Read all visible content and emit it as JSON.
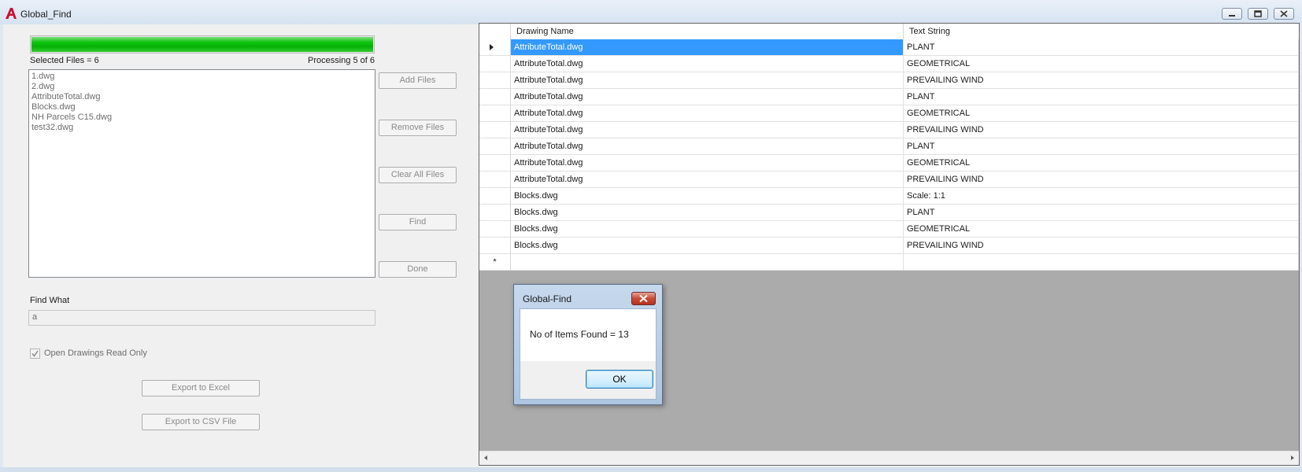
{
  "window": {
    "title": "Global_Find",
    "app_icon": "autocad-a-icon"
  },
  "progress": {
    "percent": 100,
    "selected_files_label": "Selected Files = 6",
    "processing_label": "Processing 5 of 6"
  },
  "files": [
    "1.dwg",
    "2.dwg",
    "AttributeTotal.dwg",
    "Blocks.dwg",
    "NH Parcels C15.dwg",
    "test32.dwg"
  ],
  "buttons": {
    "add_files": "Add Files",
    "remove_files": "Remove Files",
    "clear_all_files": "Clear All Files",
    "find": "Find",
    "done": "Done",
    "export_excel": "Export to Excel",
    "export_csv": "Export to CSV File"
  },
  "find_what": {
    "label": "Find What",
    "value": "a"
  },
  "read_only_checkbox": {
    "label": "Open Drawings Read Only",
    "checked": true
  },
  "grid": {
    "columns": [
      "Drawing Name",
      "Text String"
    ],
    "rows": [
      [
        "AttributeTotal.dwg",
        "PLANT"
      ],
      [
        "AttributeTotal.dwg",
        "GEOMETRICAL"
      ],
      [
        "AttributeTotal.dwg",
        "PREVAILING WIND"
      ],
      [
        "AttributeTotal.dwg",
        "PLANT"
      ],
      [
        "AttributeTotal.dwg",
        "GEOMETRICAL"
      ],
      [
        "AttributeTotal.dwg",
        "PREVAILING WIND"
      ],
      [
        "AttributeTotal.dwg",
        "PLANT"
      ],
      [
        "AttributeTotal.dwg",
        "GEOMETRICAL"
      ],
      [
        "AttributeTotal.dwg",
        "PREVAILING WIND"
      ],
      [
        "Blocks.dwg",
        "Scale: 1:1"
      ],
      [
        "Blocks.dwg",
        "PLANT"
      ],
      [
        "Blocks.dwg",
        "GEOMETRICAL"
      ],
      [
        "Blocks.dwg",
        "PREVAILING WIND"
      ]
    ],
    "selected_row": 0,
    "new_row_marker": "*"
  },
  "dialog": {
    "title": "Global-Find",
    "message": "No of Items Found = 13",
    "ok_label": "OK"
  }
}
